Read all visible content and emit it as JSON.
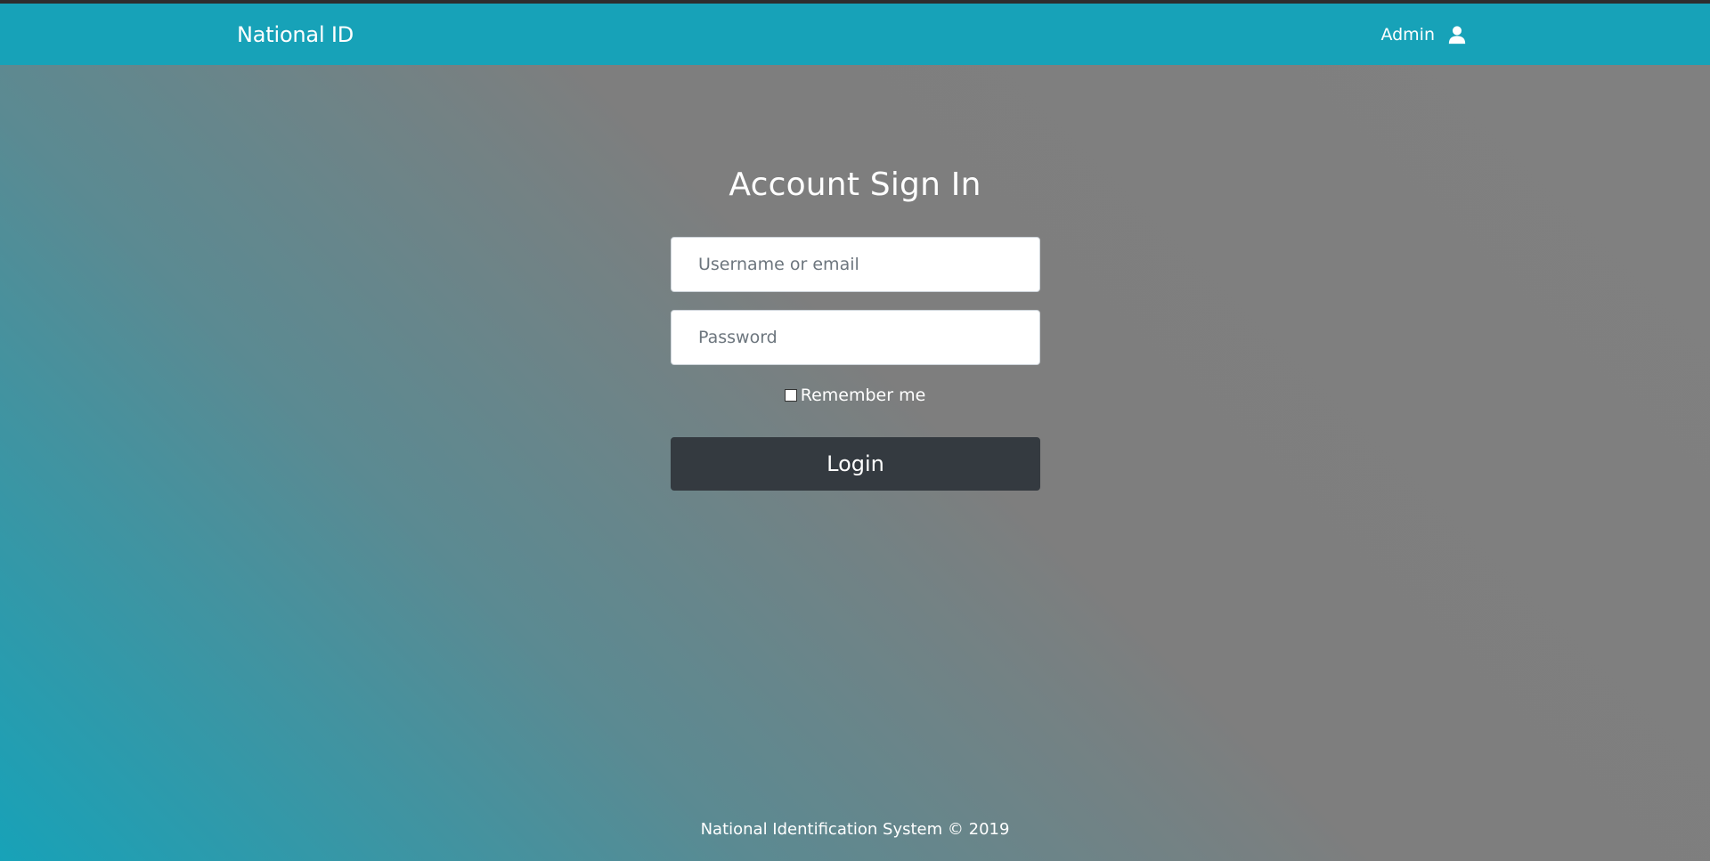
{
  "navbar": {
    "brand": "National ID",
    "user_label": "Admin",
    "user_icon": "user-icon",
    "background_color": "#17a2b8"
  },
  "signin": {
    "title": "Account Sign In",
    "username_placeholder": "Username or email",
    "username_value": "",
    "password_placeholder": "Password",
    "password_value": "",
    "remember_label": "Remember me",
    "remember_checked": false,
    "login_label": "Login",
    "login_button_color": "#343a40"
  },
  "footer": {
    "text": "National Identification System © 2019"
  }
}
